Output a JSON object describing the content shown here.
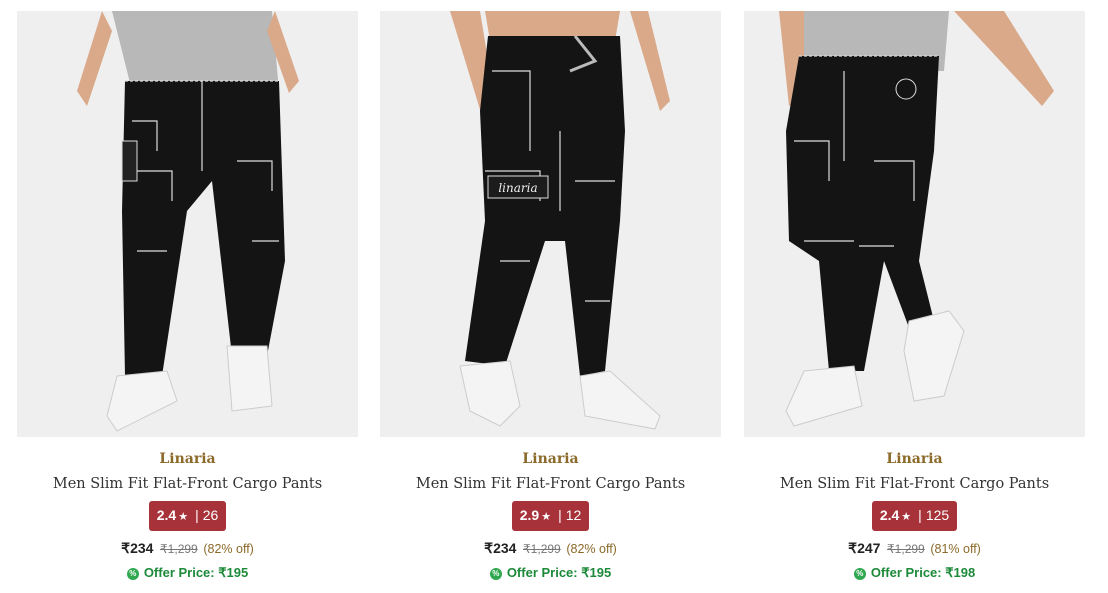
{
  "products": [
    {
      "brand": "Linaria",
      "title": "Men Slim Fit Flat-Front Cargo Pants",
      "rating": "2.4",
      "star": "★",
      "separator": "|",
      "reviews": "26",
      "price": "₹234",
      "mrp": "₹1,299",
      "discount": "(82% off)",
      "offer_icon": "%",
      "offer_price": "Offer Price: ₹195",
      "image_alt": "Men black cargo pants front view"
    },
    {
      "brand": "Linaria",
      "title": "Men Slim Fit Flat-Front Cargo Pants",
      "rating": "2.9",
      "star": "★",
      "separator": "|",
      "reviews": "12",
      "price": "₹234",
      "mrp": "₹1,299",
      "discount": "(82% off)",
      "offer_icon": "%",
      "offer_price": "Offer Price: ₹195",
      "image_alt": "Men black cargo pants with hand in pocket"
    },
    {
      "brand": "Linaria",
      "title": "Men Slim Fit Flat-Front Cargo Pants",
      "rating": "2.4",
      "star": "★",
      "separator": "|",
      "reviews": "125",
      "price": "₹247",
      "mrp": "₹1,299",
      "discount": "(81% off)",
      "offer_icon": "%",
      "offer_price": "Offer Price: ₹198",
      "image_alt": "Men black cargo pants side pose"
    }
  ],
  "colors": {
    "brand": "#8b6a2a",
    "rating_badge": "#a8323a",
    "offer_green": "#1d8a3a"
  }
}
